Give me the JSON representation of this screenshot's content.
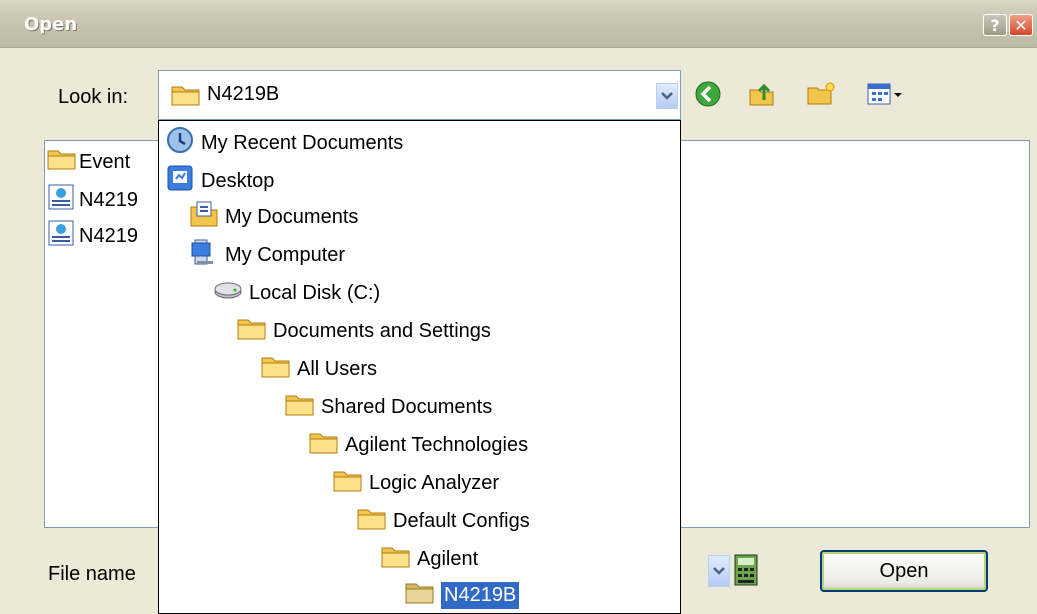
{
  "window": {
    "title": "Open",
    "help_icon": "?",
    "close_icon": "✕"
  },
  "lookin": {
    "label": "Look in:",
    "value": "N4219B"
  },
  "files": [
    {
      "name": "Event",
      "icon": "folder-icon"
    },
    {
      "name": "N4219",
      "icon": "config-file-icon"
    },
    {
      "name": "N4219",
      "icon": "config-file-icon"
    }
  ],
  "dropdown_items": [
    {
      "label": "My Recent Documents",
      "icon": "recent-documents-icon"
    },
    {
      "label": "Desktop",
      "icon": "desktop-icon"
    },
    {
      "label": "My Documents",
      "icon": "my-documents-icon"
    },
    {
      "label": "My Computer",
      "icon": "my-computer-icon"
    },
    {
      "label": "Local Disk (C:)",
      "icon": "disk-icon"
    },
    {
      "label": "Documents and Settings",
      "icon": "folder-icon"
    },
    {
      "label": "All Users",
      "icon": "folder-icon"
    },
    {
      "label": "Shared Documents",
      "icon": "folder-icon"
    },
    {
      "label": "Agilent Technologies",
      "icon": "folder-icon"
    },
    {
      "label": "Logic Analyzer",
      "icon": "folder-icon"
    },
    {
      "label": "Default Configs",
      "icon": "folder-icon"
    },
    {
      "label": "Agilent",
      "icon": "folder-icon"
    },
    {
      "label": "N4219B",
      "icon": "folder-icon",
      "selected": true
    }
  ],
  "filename": {
    "label": "File name"
  },
  "buttons": {
    "open": "Open"
  }
}
